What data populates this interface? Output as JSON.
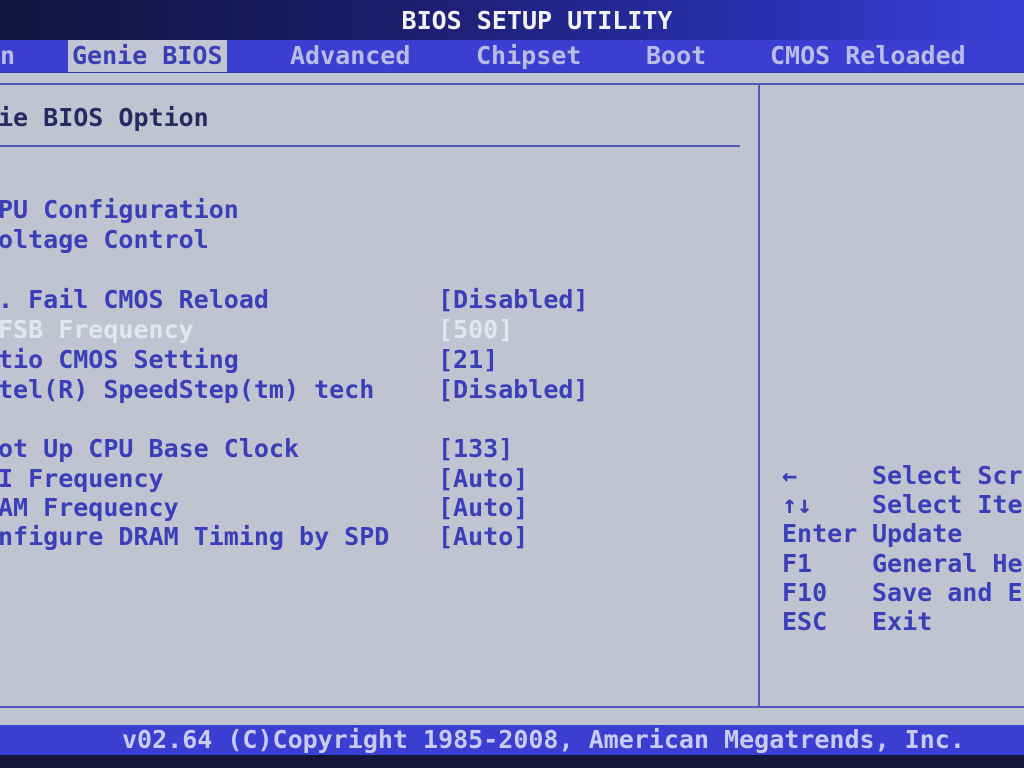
{
  "window": {
    "title": "BIOS SETUP UTILITY"
  },
  "menu": {
    "items": [
      {
        "label": "n"
      },
      {
        "label": "Genie BIOS"
      },
      {
        "label": "Advanced"
      },
      {
        "label": "Chipset"
      },
      {
        "label": "Boot"
      },
      {
        "label": "CMOS Reloaded"
      }
    ],
    "active": "Genie BIOS"
  },
  "section": {
    "title": "ie BIOS Option"
  },
  "submenus": [
    {
      "label": "PU Configuration"
    },
    {
      "label": "oltage Control"
    }
  ],
  "options": [
    {
      "label": ". Fail CMOS Reload",
      "value": "[Disabled]"
    },
    {
      "label": " FSB Frequency",
      "value": "[500]",
      "state": "selected"
    },
    {
      "label": "tio CMOS Setting",
      "value": "[21]"
    },
    {
      "label": "tel(R) SpeedStep(tm) tech",
      "value": "[Disabled]"
    },
    {
      "label": "ot Up CPU Base Clock",
      "value": "[133]"
    },
    {
      "label": "I Frequency",
      "value": "[Auto]"
    },
    {
      "label": "AM Frequency",
      "value": "[Auto]"
    },
    {
      "label": "nfigure DRAM Timing by SPD",
      "value": "[Auto]"
    }
  ],
  "help": [
    {
      "key": "←",
      "desc": "Select Scr"
    },
    {
      "key": "↑↓",
      "desc": "Select Ite"
    },
    {
      "key": "Enter",
      "desc": "Update"
    },
    {
      "key": "F1",
      "desc": "General He"
    },
    {
      "key": "F10",
      "desc": "Save and E"
    },
    {
      "key": "ESC",
      "desc": "Exit"
    }
  ],
  "footer": {
    "text": "v02.64 (C)Copyright 1985-2008, American Megatrends, Inc."
  },
  "colors": {
    "background": "#c0c3d0",
    "bar": "#3a3fd2",
    "text": "#3a3eb8",
    "highlight": "#e4e5ee"
  }
}
